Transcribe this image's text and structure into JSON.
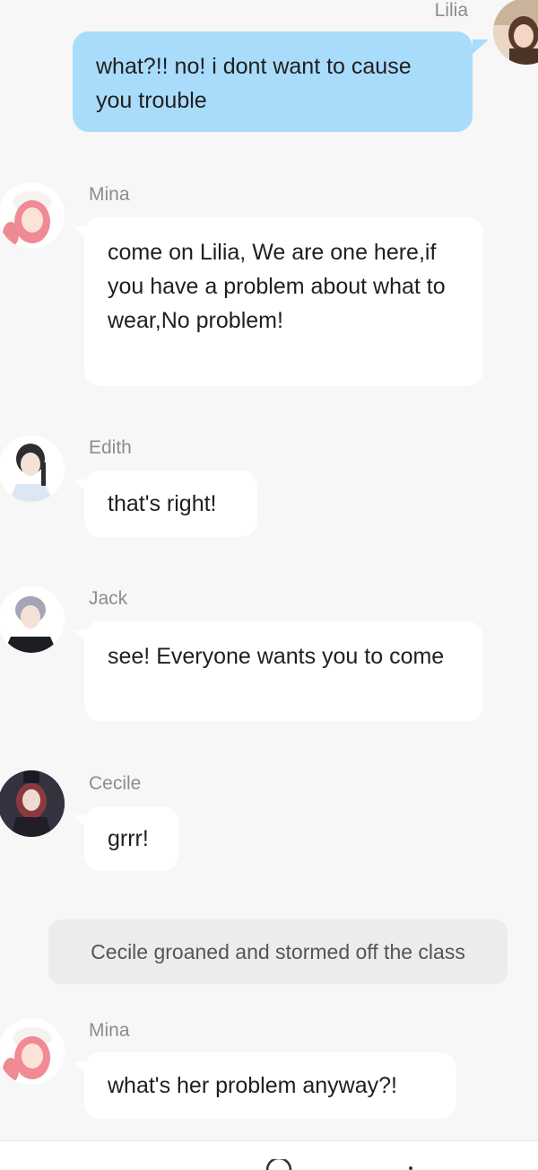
{
  "messages": [
    {
      "sender": "Lilia",
      "text": "what?!! no! i dont want to cause you trouble",
      "side": "right",
      "avatar": "lilia-avatar"
    },
    {
      "sender": "Mina",
      "text": "come on Lilia, We are one here,if you have a problem about what to wear,No problem!",
      "side": "left",
      "avatar": "mina-avatar"
    },
    {
      "sender": "Edith",
      "text": "that's right!",
      "side": "left",
      "avatar": "edith-avatar"
    },
    {
      "sender": "Jack",
      "text": "see! Everyone wants you to come",
      "side": "left",
      "avatar": "jack-avatar"
    },
    {
      "sender": "Cecile",
      "text": "grrr!",
      "side": "left",
      "avatar": "cecile-avatar"
    },
    {
      "sender": "Mina",
      "text": "what's her problem anyway?!",
      "side": "left",
      "avatar": "mina-avatar"
    }
  ],
  "narration": "Cecile groaned and stormed off the class",
  "colors": {
    "background": "#f7f7f7",
    "bubble_self": "#a9dcfb",
    "bubble_other": "#ffffff",
    "name_text": "#8d8d8d"
  }
}
